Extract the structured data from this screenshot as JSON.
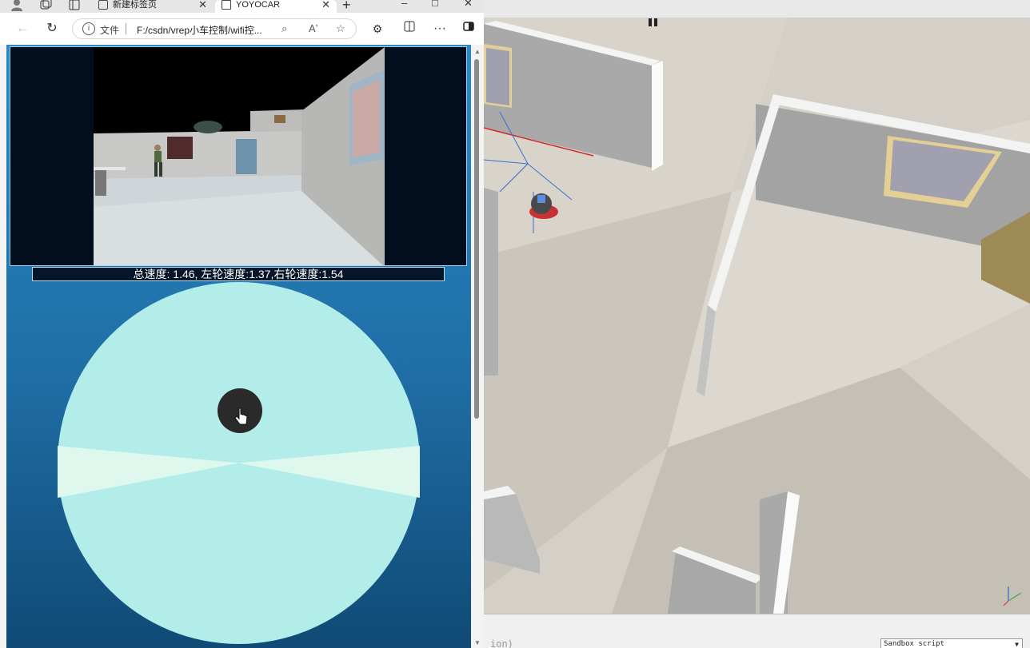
{
  "browser": {
    "tabs": [
      {
        "title": "新建标签页",
        "active": false
      },
      {
        "title": "YOYOCAR",
        "active": true
      }
    ],
    "new_tab": "+",
    "window_controls": {
      "minimize": "–",
      "maximize": "□",
      "close": "✕"
    },
    "address": {
      "security_label": "文件",
      "url": "F:/csdn/vrep小车控制/wifi控..."
    },
    "icons": {
      "profile": "profile-icon",
      "workspaces": "workspaces-icon",
      "tab_actions": "tab-actions-icon",
      "back": "back-arrow-icon",
      "refresh": "refresh-icon",
      "info": "info-icon",
      "zoom": "zoom-icon",
      "read_aloud": "read-aloud-icon",
      "favorite": "star-icon",
      "extensions": "extensions-icon",
      "split": "split-screen-icon",
      "more": "more-icon",
      "sidebar": "sidebar-icon"
    }
  },
  "page": {
    "speed_text": "总速度: 1.46, 左轮速度:1.37,右轮速度:1.54",
    "colors": {
      "joystick_base": "#b3ede9",
      "joystick_dead_zone": "#dff8ee",
      "joystick_knob": "#2a2a2a",
      "background_top": "#2a8ac6",
      "background_bottom": "#104a75"
    }
  },
  "sim": {
    "console_text": "ion)",
    "script_selector": "Sandbox script"
  }
}
